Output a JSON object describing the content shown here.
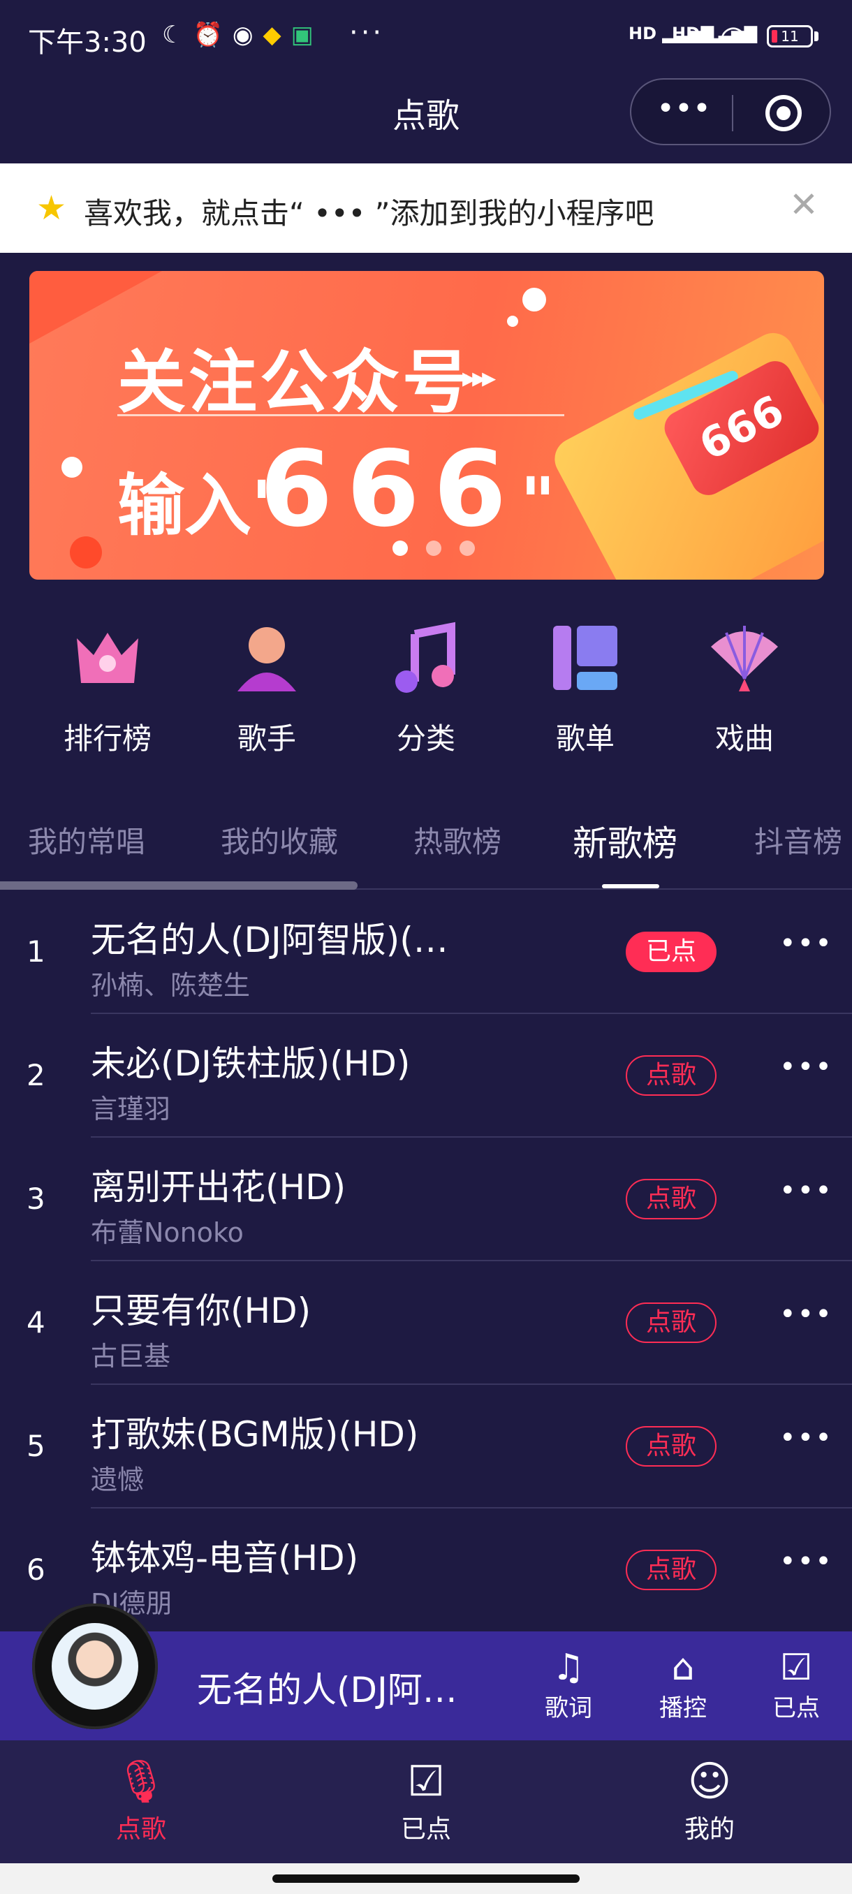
{
  "status_bar": {
    "time": "下午3:30",
    "left_icons": [
      "moon-icon",
      "alarm-icon",
      "wechat-icon",
      "qq-icon",
      "browser-icon"
    ],
    "more": "···",
    "signal1": "HD",
    "signal2": "HD",
    "battery": "11"
  },
  "nav": {
    "title": "点歌",
    "menu_label": "•••"
  },
  "tip": {
    "text": "喜欢我，就点击“ ••• ”添加到我的小程序吧",
    "close": "✕"
  },
  "banner": {
    "line1": "关注公众号",
    "arrows": "▸▸▸",
    "line2_prefix": "输入\"",
    "line2_number": "666",
    "line2_suffix": "\"",
    "phone_badge": "666",
    "active_slide": 1,
    "slide_count": 3
  },
  "categories": [
    {
      "label": "排行榜",
      "icon": "crown-icon"
    },
    {
      "label": "歌手",
      "icon": "singer-icon"
    },
    {
      "label": "分类",
      "icon": "music-note-icon"
    },
    {
      "label": "歌单",
      "icon": "playlist-icon"
    },
    {
      "label": "戏曲",
      "icon": "fan-icon"
    }
  ],
  "tabs": [
    "我的常唱",
    "我的收藏",
    "热歌榜",
    "新歌榜",
    "抖音榜"
  ],
  "active_tab": "新歌榜",
  "songs": [
    {
      "rank": "1",
      "title": "无名的人(DJ阿智版)(…",
      "artist": "孙楠、陈楚生",
      "button": "已点",
      "state": "ordered"
    },
    {
      "rank": "2",
      "title": "未必(DJ铁柱版)(HD)",
      "artist": "言瑾羽",
      "button": "点歌",
      "state": "order"
    },
    {
      "rank": "3",
      "title": "离别开出花(HD)",
      "artist": "布蕾Nonoko",
      "button": "点歌",
      "state": "order"
    },
    {
      "rank": "4",
      "title": "只要有你(HD)",
      "artist": "古巨基",
      "button": "点歌",
      "state": "order"
    },
    {
      "rank": "5",
      "title": "打歌妹(BGM版)(HD)",
      "artist": "遗憾",
      "button": "点歌",
      "state": "order"
    },
    {
      "rank": "6",
      "title": "钵钵鸡-电音(HD)",
      "artist": "DJ德朋",
      "button": "点歌",
      "state": "order"
    }
  ],
  "more_label": "•••",
  "player": {
    "song": "无名的人(DJ阿…",
    "lyrics_label": "歌词",
    "control_label": "播控",
    "ordered_label": "已点"
  },
  "bottom_nav": [
    {
      "label": "点歌",
      "icon": "microphone-icon",
      "active": true
    },
    {
      "label": "已点",
      "icon": "checklist-icon",
      "active": false
    },
    {
      "label": "我的",
      "icon": "smile-icon",
      "active": false
    }
  ],
  "colors": {
    "background": "#1e1a42",
    "accent": "#ff2d55",
    "player_bar": "#3a2a9a",
    "muted_text": "#8c88ad"
  }
}
